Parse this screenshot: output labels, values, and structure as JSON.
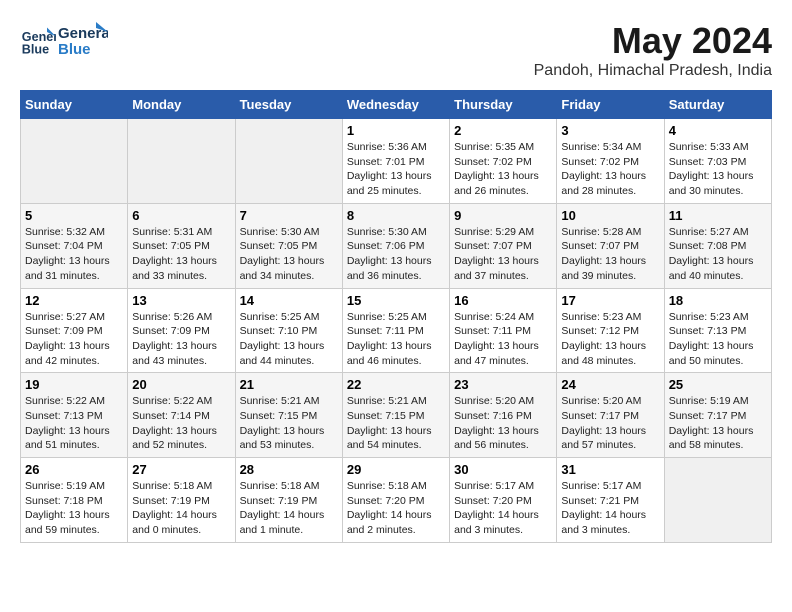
{
  "logo": {
    "line1": "General",
    "line2": "Blue"
  },
  "title": "May 2024",
  "subtitle": "Pandoh, Himachal Pradesh, India",
  "weekdays": [
    "Sunday",
    "Monday",
    "Tuesday",
    "Wednesday",
    "Thursday",
    "Friday",
    "Saturday"
  ],
  "weeks": [
    [
      {
        "day": "",
        "info": ""
      },
      {
        "day": "",
        "info": ""
      },
      {
        "day": "",
        "info": ""
      },
      {
        "day": "1",
        "info": "Sunrise: 5:36 AM\nSunset: 7:01 PM\nDaylight: 13 hours\nand 25 minutes."
      },
      {
        "day": "2",
        "info": "Sunrise: 5:35 AM\nSunset: 7:02 PM\nDaylight: 13 hours\nand 26 minutes."
      },
      {
        "day": "3",
        "info": "Sunrise: 5:34 AM\nSunset: 7:02 PM\nDaylight: 13 hours\nand 28 minutes."
      },
      {
        "day": "4",
        "info": "Sunrise: 5:33 AM\nSunset: 7:03 PM\nDaylight: 13 hours\nand 30 minutes."
      }
    ],
    [
      {
        "day": "5",
        "info": "Sunrise: 5:32 AM\nSunset: 7:04 PM\nDaylight: 13 hours\nand 31 minutes."
      },
      {
        "day": "6",
        "info": "Sunrise: 5:31 AM\nSunset: 7:05 PM\nDaylight: 13 hours\nand 33 minutes."
      },
      {
        "day": "7",
        "info": "Sunrise: 5:30 AM\nSunset: 7:05 PM\nDaylight: 13 hours\nand 34 minutes."
      },
      {
        "day": "8",
        "info": "Sunrise: 5:30 AM\nSunset: 7:06 PM\nDaylight: 13 hours\nand 36 minutes."
      },
      {
        "day": "9",
        "info": "Sunrise: 5:29 AM\nSunset: 7:07 PM\nDaylight: 13 hours\nand 37 minutes."
      },
      {
        "day": "10",
        "info": "Sunrise: 5:28 AM\nSunset: 7:07 PM\nDaylight: 13 hours\nand 39 minutes."
      },
      {
        "day": "11",
        "info": "Sunrise: 5:27 AM\nSunset: 7:08 PM\nDaylight: 13 hours\nand 40 minutes."
      }
    ],
    [
      {
        "day": "12",
        "info": "Sunrise: 5:27 AM\nSunset: 7:09 PM\nDaylight: 13 hours\nand 42 minutes."
      },
      {
        "day": "13",
        "info": "Sunrise: 5:26 AM\nSunset: 7:09 PM\nDaylight: 13 hours\nand 43 minutes."
      },
      {
        "day": "14",
        "info": "Sunrise: 5:25 AM\nSunset: 7:10 PM\nDaylight: 13 hours\nand 44 minutes."
      },
      {
        "day": "15",
        "info": "Sunrise: 5:25 AM\nSunset: 7:11 PM\nDaylight: 13 hours\nand 46 minutes."
      },
      {
        "day": "16",
        "info": "Sunrise: 5:24 AM\nSunset: 7:11 PM\nDaylight: 13 hours\nand 47 minutes."
      },
      {
        "day": "17",
        "info": "Sunrise: 5:23 AM\nSunset: 7:12 PM\nDaylight: 13 hours\nand 48 minutes."
      },
      {
        "day": "18",
        "info": "Sunrise: 5:23 AM\nSunset: 7:13 PM\nDaylight: 13 hours\nand 50 minutes."
      }
    ],
    [
      {
        "day": "19",
        "info": "Sunrise: 5:22 AM\nSunset: 7:13 PM\nDaylight: 13 hours\nand 51 minutes."
      },
      {
        "day": "20",
        "info": "Sunrise: 5:22 AM\nSunset: 7:14 PM\nDaylight: 13 hours\nand 52 minutes."
      },
      {
        "day": "21",
        "info": "Sunrise: 5:21 AM\nSunset: 7:15 PM\nDaylight: 13 hours\nand 53 minutes."
      },
      {
        "day": "22",
        "info": "Sunrise: 5:21 AM\nSunset: 7:15 PM\nDaylight: 13 hours\nand 54 minutes."
      },
      {
        "day": "23",
        "info": "Sunrise: 5:20 AM\nSunset: 7:16 PM\nDaylight: 13 hours\nand 56 minutes."
      },
      {
        "day": "24",
        "info": "Sunrise: 5:20 AM\nSunset: 7:17 PM\nDaylight: 13 hours\nand 57 minutes."
      },
      {
        "day": "25",
        "info": "Sunrise: 5:19 AM\nSunset: 7:17 PM\nDaylight: 13 hours\nand 58 minutes."
      }
    ],
    [
      {
        "day": "26",
        "info": "Sunrise: 5:19 AM\nSunset: 7:18 PM\nDaylight: 13 hours\nand 59 minutes."
      },
      {
        "day": "27",
        "info": "Sunrise: 5:18 AM\nSunset: 7:19 PM\nDaylight: 14 hours\nand 0 minutes."
      },
      {
        "day": "28",
        "info": "Sunrise: 5:18 AM\nSunset: 7:19 PM\nDaylight: 14 hours\nand 1 minute."
      },
      {
        "day": "29",
        "info": "Sunrise: 5:18 AM\nSunset: 7:20 PM\nDaylight: 14 hours\nand 2 minutes."
      },
      {
        "day": "30",
        "info": "Sunrise: 5:17 AM\nSunset: 7:20 PM\nDaylight: 14 hours\nand 3 minutes."
      },
      {
        "day": "31",
        "info": "Sunrise: 5:17 AM\nSunset: 7:21 PM\nDaylight: 14 hours\nand 3 minutes."
      },
      {
        "day": "",
        "info": ""
      }
    ]
  ]
}
